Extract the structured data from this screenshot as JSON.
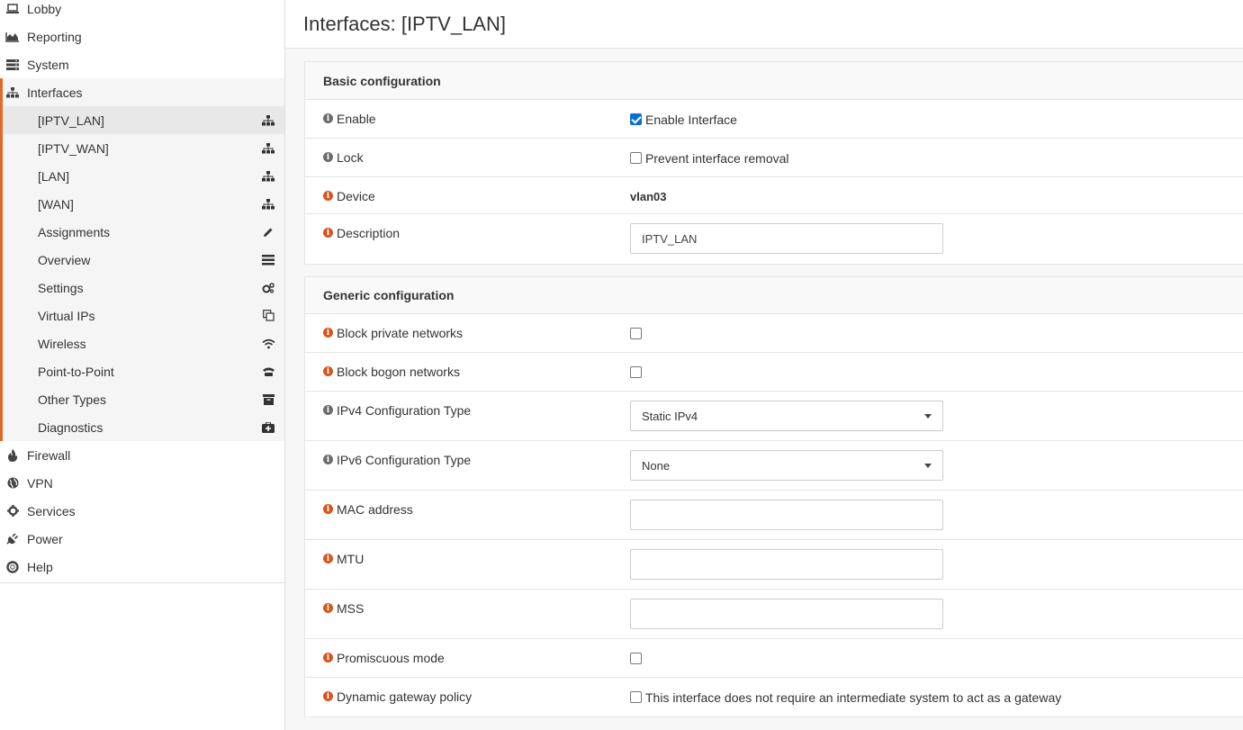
{
  "sidebar": {
    "top_items": [
      {
        "label": "Lobby",
        "icon": "laptop-icon"
      },
      {
        "label": "Reporting",
        "icon": "area-chart-icon"
      },
      {
        "label": "System",
        "icon": "server-icon"
      }
    ],
    "interfaces": {
      "label": "Interfaces",
      "icon": "sitemap-icon",
      "items": [
        {
          "label": "[IPTV_LAN]",
          "icon": "sitemap-icon",
          "active": true
        },
        {
          "label": "[IPTV_WAN]",
          "icon": "sitemap-icon"
        },
        {
          "label": "[LAN]",
          "icon": "sitemap-icon"
        },
        {
          "label": "[WAN]",
          "icon": "sitemap-icon"
        },
        {
          "label": "Assignments",
          "icon": "pencil-icon"
        },
        {
          "label": "Overview",
          "icon": "list-icon"
        },
        {
          "label": "Settings",
          "icon": "gears-icon"
        },
        {
          "label": "Virtual IPs",
          "icon": "copy-icon"
        },
        {
          "label": "Wireless",
          "icon": "wifi-icon"
        },
        {
          "label": "Point-to-Point",
          "icon": "phone-icon"
        },
        {
          "label": "Other Types",
          "icon": "archive-icon"
        },
        {
          "label": "Diagnostics",
          "icon": "medkit-icon"
        }
      ]
    },
    "bottom_items": [
      {
        "label": "Firewall",
        "icon": "fire-icon"
      },
      {
        "label": "VPN",
        "icon": "globe-icon"
      },
      {
        "label": "Services",
        "icon": "cog-icon"
      },
      {
        "label": "Power",
        "icon": "plug-icon"
      },
      {
        "label": "Help",
        "icon": "life-ring-icon"
      }
    ]
  },
  "page": {
    "title": "Interfaces: [IPTV_LAN]"
  },
  "basic": {
    "heading": "Basic configuration",
    "enable_label": "Enable",
    "enable_checkbox_label": "Enable Interface",
    "enable_checked": true,
    "lock_label": "Lock",
    "lock_checkbox_label": "Prevent interface removal",
    "device_label": "Device",
    "device_value": "vlan03",
    "description_label": "Description",
    "description_value": "IPTV_LAN"
  },
  "generic": {
    "heading": "Generic configuration",
    "block_private_label": "Block private networks",
    "block_bogon_label": "Block bogon networks",
    "ipv4_type_label": "IPv4 Configuration Type",
    "ipv4_type_value": "Static IPv4",
    "ipv6_type_label": "IPv6 Configuration Type",
    "ipv6_type_value": "None",
    "mac_label": "MAC address",
    "mac_value": "",
    "mtu_label": "MTU",
    "mtu_value": "",
    "mss_label": "MSS",
    "mss_value": "",
    "promisc_label": "Promiscuous mode",
    "dyn_gw_label": "Dynamic gateway policy",
    "dyn_gw_checkbox_label": "This interface does not require an intermediate system to act as a gateway"
  },
  "colors": {
    "accent": "#e06a2b",
    "info_orange": "#d9541b",
    "info_gray": "#6b6b6b",
    "checkbox_blue": "#0a6ed8"
  }
}
